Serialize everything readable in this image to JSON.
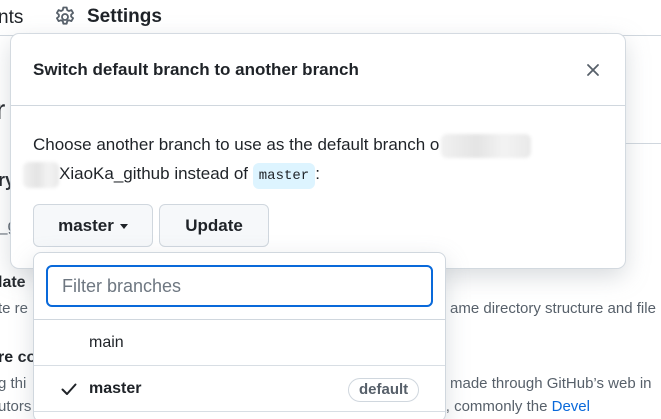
{
  "topnav": {
    "prev_tab_fragment": "nts",
    "settings_label": "Settings"
  },
  "background": {
    "frag_big": "r",
    "frag_ry": "ry",
    "frag_g": "_g",
    "frag_date": "late",
    "frag_tre": "te re",
    "frag_ame": "ame directory structure and file",
    "frag_reco": "re co",
    "frag_gth": "g thi",
    "frag_made": "made through GitHub’s web in",
    "frag_utors": "utors to affirm that their commit complies with the repository's terms, commonly the ",
    "frag_devel": "Devel"
  },
  "modal": {
    "title": "Switch default branch to another branch",
    "body_prefix": "Choose another branch to use as the default branch o",
    "body_repo": "XiaoKa_github instead of ",
    "current_branch_code": "master",
    "body_suffix": ":",
    "branch_button_label": "master",
    "update_button_label": "Update"
  },
  "dropdown": {
    "filter_placeholder": "Filter branches",
    "filter_value": "",
    "branches": [
      {
        "name": "main",
        "selected": false,
        "badge": ""
      },
      {
        "name": "master",
        "selected": true,
        "badge": "default"
      }
    ]
  },
  "colors": {
    "accent": "#0969da",
    "code_bg": "#ddf4ff",
    "border": "#d0d7de"
  }
}
